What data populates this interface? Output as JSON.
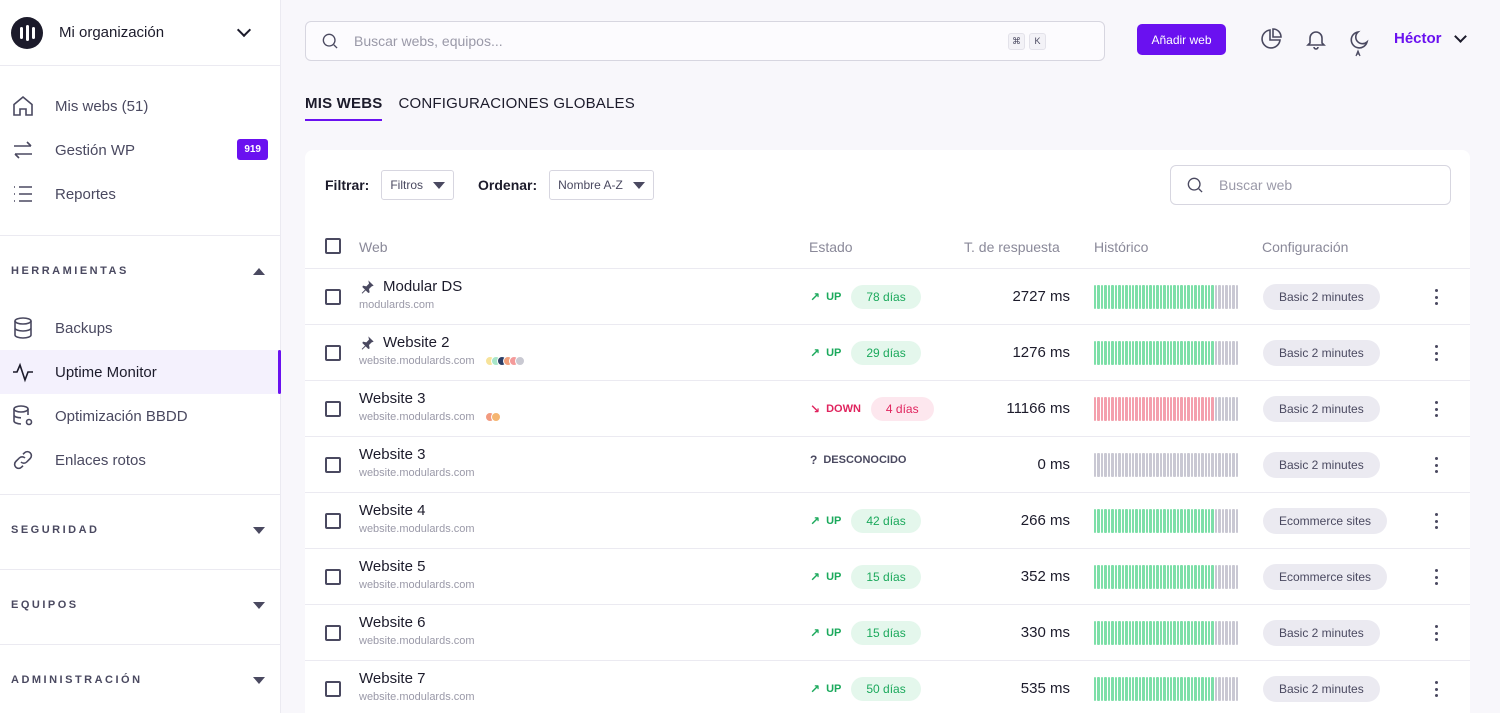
{
  "org": {
    "name": "Mi organización"
  },
  "nav": {
    "items": [
      {
        "label": "Mis webs (51)",
        "icon": "home-icon"
      },
      {
        "label": "Gestión WP",
        "icon": "arrows-swap-icon",
        "badge": "919"
      },
      {
        "label": "Reportes",
        "icon": "list-icon"
      }
    ]
  },
  "sections": {
    "herramientas": {
      "title": "HERRAMIENTAS",
      "items": [
        {
          "label": "Backups",
          "icon": "database-icon"
        },
        {
          "label": "Uptime Monitor",
          "icon": "pulse-icon"
        },
        {
          "label": "Optimización BBDD",
          "icon": "database-gear-icon"
        },
        {
          "label": "Enlaces rotos",
          "icon": "link-icon"
        }
      ]
    },
    "seguridad": {
      "title": "SEGURIDAD"
    },
    "equipos": {
      "title": "EQUIPOS"
    },
    "administracion": {
      "title": "ADMINISTRACIÓN"
    }
  },
  "topbar": {
    "search_placeholder": "Buscar webs, equipos...",
    "kbd1": "⌘",
    "kbd2": "K",
    "add_button": "Añadir web",
    "user": "Héctor"
  },
  "tabs": [
    {
      "label": "MIS WEBS",
      "active": true
    },
    {
      "label": "CONFIGURACIONES GLOBALES",
      "active": false
    }
  ],
  "filters": {
    "filter_label": "Filtrar:",
    "filter_value": "Filtros",
    "order_label": "Ordenar:",
    "order_value": "Nombre A-Z",
    "search_placeholder": "Buscar web"
  },
  "table": {
    "headers": {
      "web": "Web",
      "estado": "Estado",
      "respuesta": "T. de respuesta",
      "historico": "Histórico",
      "configuracion": "Configuración"
    },
    "rows": [
      {
        "name": "Modular DS",
        "url": "modulards.com",
        "pinned": true,
        "dots": [],
        "status": "up",
        "status_label": "UP",
        "days": "78 días",
        "response": "2727 ms",
        "config": "Basic 2 minutes"
      },
      {
        "name": "Website 2",
        "url": "website.modulards.com",
        "pinned": true,
        "dots": [
          "#f7e39a",
          "#a8e6c9",
          "#2c3e66",
          "#f2a07b",
          "#f49a9a",
          "#c9c9d2"
        ],
        "status": "up",
        "status_label": "UP",
        "days": "29 días",
        "response": "1276 ms",
        "config": "Basic 2 minutes"
      },
      {
        "name": "Website 3",
        "url": "website.modulards.com",
        "pinned": false,
        "dots": [
          "#f29a7f",
          "#f5b571"
        ],
        "status": "down",
        "status_label": "DOWN",
        "days": "4 días",
        "response": "11166 ms",
        "config": "Basic 2 minutes"
      },
      {
        "name": "Website 3",
        "url": "website.modulards.com",
        "pinned": false,
        "dots": [],
        "status": "unknown",
        "status_label": "DESCONOCIDO",
        "days": "",
        "response": "0 ms",
        "config": "Basic 2 minutes"
      },
      {
        "name": "Website 4",
        "url": "website.modulards.com",
        "pinned": false,
        "dots": [],
        "status": "up",
        "status_label": "UP",
        "days": "42 días",
        "response": "266 ms",
        "config": "Ecommerce sites"
      },
      {
        "name": "Website 5",
        "url": "website.modulards.com",
        "pinned": false,
        "dots": [],
        "status": "up",
        "status_label": "UP",
        "days": "15 días",
        "response": "352 ms",
        "config": "Ecommerce sites"
      },
      {
        "name": "Website 6",
        "url": "website.modulards.com",
        "pinned": false,
        "dots": [],
        "status": "up",
        "status_label": "UP",
        "days": "15 días",
        "response": "330 ms",
        "config": "Basic 2 minutes"
      },
      {
        "name": "Website 7",
        "url": "website.modulards.com",
        "pinned": false,
        "dots": [],
        "status": "up",
        "status_label": "UP",
        "days": "50 días",
        "response": "535 ms",
        "config": "Basic 2 minutes"
      }
    ]
  },
  "colors": {
    "accent": "#6a11f0",
    "up": "#1ba95c",
    "down": "#e0245e",
    "bar_up": "#7ddfa8",
    "bar_down": "#f4a0ad",
    "bar_none": "#c9c8d3"
  }
}
